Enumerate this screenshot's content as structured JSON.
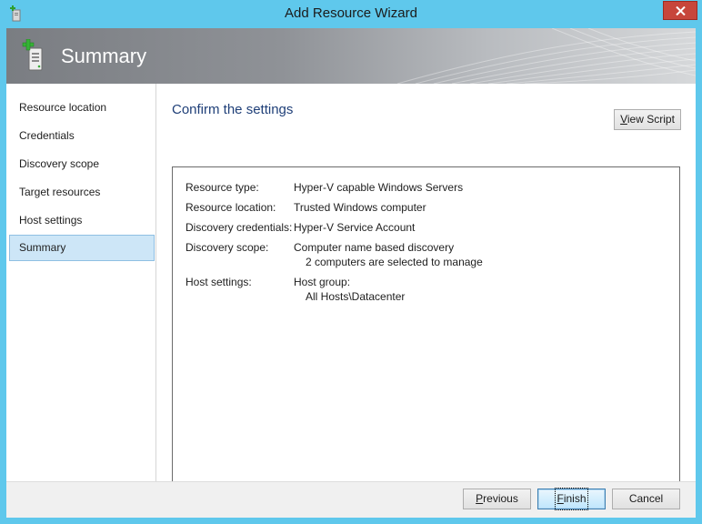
{
  "window": {
    "title": "Add Resource Wizard",
    "close_label": "close"
  },
  "banner": {
    "title": "Summary",
    "icon": "server-add-icon"
  },
  "nav": {
    "items": [
      {
        "label": "Resource location",
        "selected": false
      },
      {
        "label": "Credentials",
        "selected": false
      },
      {
        "label": "Discovery scope",
        "selected": false
      },
      {
        "label": "Target resources",
        "selected": false
      },
      {
        "label": "Host settings",
        "selected": false
      },
      {
        "label": "Summary",
        "selected": true
      }
    ]
  },
  "main": {
    "title": "Confirm the settings",
    "view_script": {
      "pre": "",
      "accel": "V",
      "post": "iew Script"
    }
  },
  "summary": {
    "resource_type": {
      "label": "Resource type:",
      "value": "Hyper-V capable Windows Servers"
    },
    "resource_location": {
      "label": "Resource location:",
      "value": "Trusted Windows computer"
    },
    "discovery_credentials": {
      "label": "Discovery credentials:",
      "value": "Hyper-V Service Account"
    },
    "discovery_scope": {
      "label": "Discovery scope:",
      "value": "Computer name based discovery",
      "detail": "2 computers are selected to manage"
    },
    "host_settings": {
      "label": "Host settings:",
      "value": "Host group:",
      "detail": "All Hosts\\Datacenter"
    }
  },
  "buttons": {
    "previous": {
      "pre": "",
      "accel": "P",
      "post": "revious"
    },
    "finish": {
      "pre": "",
      "accel": "F",
      "post": "inish"
    },
    "cancel": {
      "label": "Cancel"
    }
  },
  "colors": {
    "frame": "#5fc8ec",
    "accent_title": "#1f3f78",
    "selected_nav": "#cde6f7",
    "close": "#c7463b"
  }
}
